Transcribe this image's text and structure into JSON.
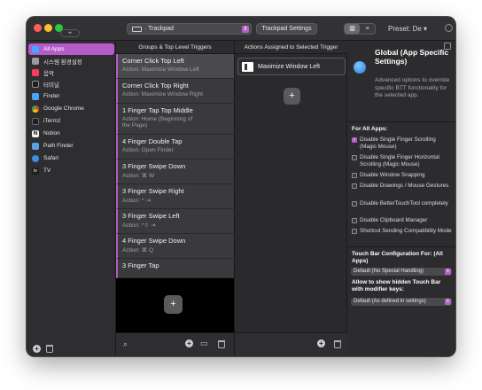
{
  "titlebar": {
    "device": "Trackpad",
    "settings_button": "Trackpad Settings",
    "view_grid": "▥",
    "view_list": "≡",
    "preset": "Preset: De ▾"
  },
  "sidebar": {
    "items": [
      {
        "label": "All Apps",
        "color": "#4aa3ff"
      },
      {
        "label": "시스템 환경설정",
        "color": "#9a9aa0"
      },
      {
        "label": "음악",
        "color": "#fa3c5b"
      },
      {
        "label": "터미널",
        "color": "#1e1e1e"
      },
      {
        "label": "Finder",
        "color": "#4aa3ff"
      },
      {
        "label": "Google Chrome",
        "color": "#f2b230"
      },
      {
        "label": "iTerm2",
        "color": "#1e1e1e"
      },
      {
        "label": "Notion",
        "color": "#f2f2f2"
      },
      {
        "label": "Path Finder",
        "color": "#5aa0e6"
      },
      {
        "label": "Safari",
        "color": "#3a8ee6"
      },
      {
        "label": "TV",
        "color": "#1e1e1e"
      }
    ]
  },
  "columns": {
    "triggers_header": "Groups & Top Level Triggers",
    "actions_header": "Actions Assigned to Selected Trigger"
  },
  "triggers": [
    {
      "title": "Corner Click Top Left",
      "action": "Action: Maximize Window Left"
    },
    {
      "title": "Corner Click Top Right",
      "action": "Action: Maximize Window Right"
    },
    {
      "title": "1 Finger Tap Top Middle",
      "action": "Action: Home (Beginning of",
      "action2": "the Page)"
    },
    {
      "title": "4 Finger Double Tap",
      "action": "Action: Open Finder"
    },
    {
      "title": "3 Finger Swipe Down",
      "action": "Action: ⌘ W"
    },
    {
      "title": "3 Finger Swipe Right",
      "action": "Action: ^ ⇥"
    },
    {
      "title": "3 Finger Swipe Left",
      "action": "Action: ^⇧ ⇥"
    },
    {
      "title": "4 Finger Swipe Down",
      "action": "Action: ⌘ Q"
    },
    {
      "title": "3 Finger Tap",
      "action": ""
    }
  ],
  "actions": [
    {
      "label": "Maximize Window Left"
    }
  ],
  "panel": {
    "title": "Global (App Specific Settings)",
    "description": "Advanced options to override specific BTT functionality for the selected app.",
    "for_all_apps": "For All Apps:",
    "options": [
      {
        "label": "Disable Single Finger Scrolling (Magic Mouse)",
        "checked": true
      },
      {
        "label": "Disable Single Finger Horizontal Scrolling (Magic Mouse)",
        "checked": false
      },
      {
        "label": "Disable Window Snapping",
        "checked": false
      },
      {
        "label": "Disable Drawings / Mouse Gestures",
        "checked": false
      },
      {
        "label": "Disable BetterTouchTool completely",
        "checked": false
      },
      {
        "label": "Disable Clipboard Manager",
        "checked": false
      },
      {
        "label": "Shortcut Sending Compatibility Mode",
        "checked": false
      }
    ],
    "touchbar_label": "Touch Bar Configuration For: (All Apps)",
    "touchbar_value": "Default (No Special Handling)",
    "hidden_touchbar_label": "Allow to show hidden Touch Bar with modifier keys:",
    "hidden_touchbar_value": "Default (As defined in settings)"
  }
}
